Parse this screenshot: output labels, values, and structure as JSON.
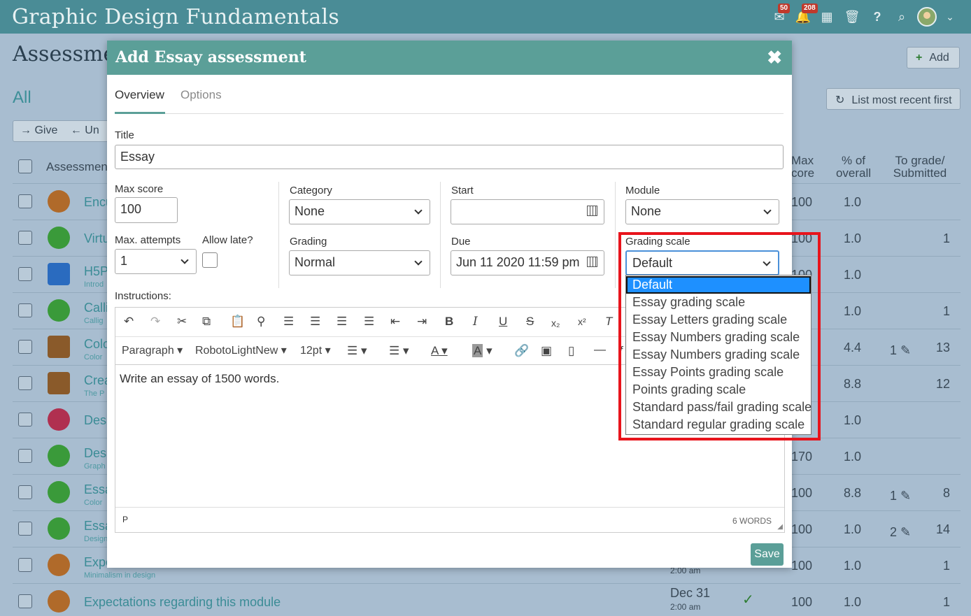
{
  "app": {
    "title": "Graphic Design Fundamentals",
    "mail_count": "50",
    "notif_count": "208"
  },
  "background": {
    "heading": "Assessme",
    "filter": "All",
    "add_label": "Add",
    "sort_label": "List most recent first",
    "give_label": "Give",
    "un_label": "Un",
    "col_assessment": "Assessmen",
    "col_max": "Max\ncore",
    "col_max1": "Max",
    "col_max2": "core",
    "col_pct1": "% of",
    "col_pct2": "overall",
    "col_grade1": "To grade/",
    "col_grade2": "Submitted",
    "rows": [
      {
        "title": "Encu",
        "sub": "",
        "max": "100",
        "pct": "1.0",
        "tograde": "",
        "sub_count": ""
      },
      {
        "title": "Virtu",
        "sub": "",
        "max": "100",
        "pct": "1.0",
        "tograde": "",
        "sub_count": "1"
      },
      {
        "title": "H5P",
        "sub": "Introd",
        "max": "100",
        "pct": "1.0",
        "tograde": "",
        "sub_count": ""
      },
      {
        "title": "Calli",
        "sub": "Callig",
        "max": "",
        "pct": "1.0",
        "tograde": "",
        "sub_count": "1"
      },
      {
        "title": "Colo",
        "sub": "Color",
        "max": "",
        "pct": "4.4",
        "tograde": "1",
        "sub_count": "13"
      },
      {
        "title": "Crea",
        "sub": "The P",
        "max": "",
        "pct": "8.8",
        "tograde": "",
        "sub_count": "12"
      },
      {
        "title": "Desi",
        "sub": "",
        "max": "",
        "pct": "1.0",
        "tograde": "",
        "sub_count": ""
      },
      {
        "title": "Desi",
        "sub": "Graph",
        "max": "170",
        "pct": "1.0",
        "tograde": "",
        "sub_count": ""
      },
      {
        "title": "Essa",
        "sub": "Color",
        "max": "100",
        "pct": "8.8",
        "tograde": "1",
        "sub_count": "8"
      },
      {
        "title": "Essa",
        "sub": "Design",
        "max": "100",
        "pct": "1.0",
        "tograde": "2",
        "sub_count": "14"
      },
      {
        "title": "Expe",
        "sub": "Minimalism in design",
        "max": "100",
        "pct": "1.0",
        "tograde": "",
        "sub_count": "1"
      },
      {
        "title": "Expectations regarding this module",
        "sub": "",
        "max": "100",
        "pct": "1.0",
        "tograde": "",
        "sub_count": "1"
      }
    ],
    "row11_time": "2:00 am",
    "row12_date": "Dec 31",
    "row12_time": "2:00 am"
  },
  "modal": {
    "title": "Add Essay assessment",
    "close": "✖",
    "tabs": [
      "Overview",
      "Options"
    ],
    "title_label": "Title",
    "title_value": "Essay",
    "max_score_label": "Max score",
    "max_score_value": "100",
    "attempts_label": "Max. attempts",
    "attempts_value": "1",
    "allow_late_label": "Allow late?",
    "category_label": "Category",
    "category_value": "None",
    "grading_label": "Grading",
    "grading_value": "Normal",
    "start_label": "Start",
    "start_value": "",
    "due_label": "Due",
    "due_value": "Jun 11 2020 11:59 pm",
    "module_label": "Module",
    "module_value": "None",
    "scale_label": "Grading scale",
    "scale_value": "Default",
    "instructions_label": "Instructions:",
    "editor": {
      "format": "Paragraph",
      "font": "RobotoLightNew",
      "size": "12pt",
      "content": "Write an essay of 1500 words.",
      "path": "P",
      "word_count": "6 WORDS"
    },
    "save_label": "Save"
  },
  "scale_options": [
    "Default",
    "Essay grading scale",
    "Essay Letters grading scale",
    "Essay Numbers grading scale",
    "Essay Numbers grading scale",
    "Essay Points grading scale",
    "Points grading scale",
    "Standard pass/fail grading scale",
    "Standard regular grading scale"
  ],
  "colors": {
    "topbar": "#4a8c96",
    "accent": "#5b9f98",
    "highlight": "#1e90ff",
    "annotation": "#e8141c"
  }
}
